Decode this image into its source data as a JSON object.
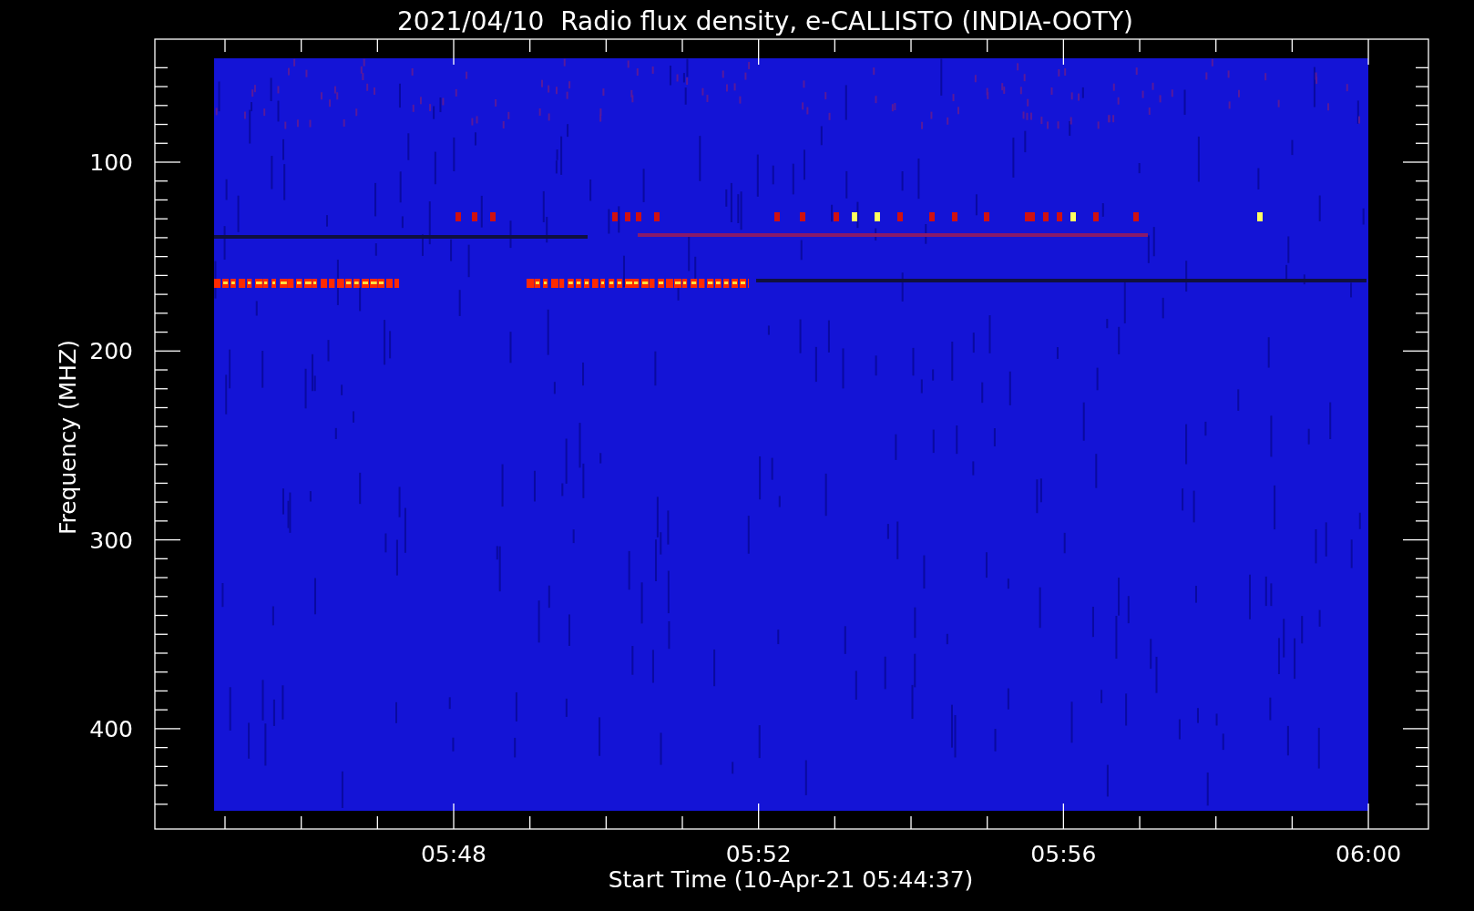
{
  "plot": {
    "title": "2021/04/10  Radio flux density, e-CALLISTO (INDIA-OOTY)",
    "ylabel": "Frequency (MHZ)",
    "xlabel": "Start Time (10-Apr-21 05:44:37)",
    "y_tick_labels": [
      "100",
      "200",
      "300",
      "400"
    ],
    "x_tick_labels": [
      "05:48",
      "05:52",
      "05:56",
      "06:00"
    ]
  }
}
